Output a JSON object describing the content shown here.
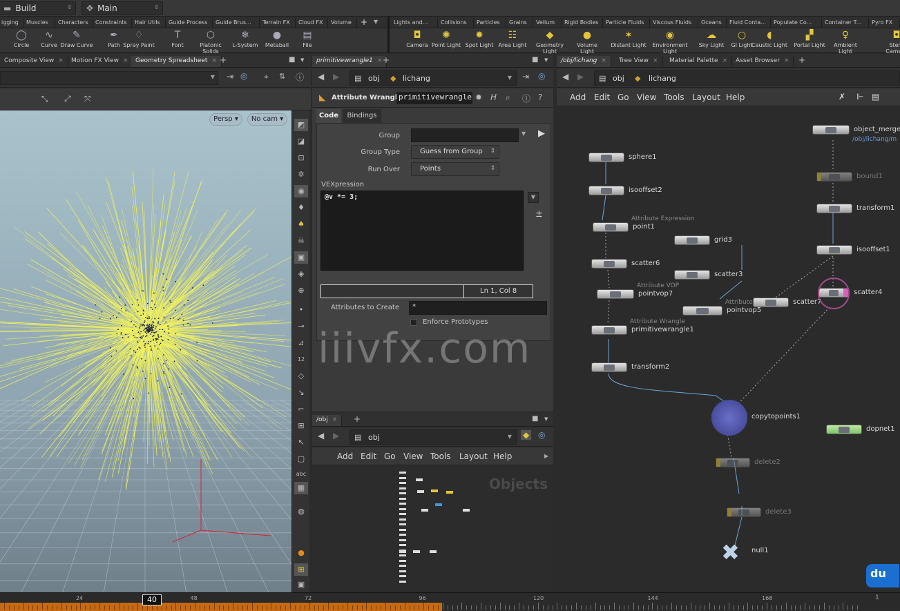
{
  "top": {
    "desktop": "Build",
    "desk2": "Main"
  },
  "shelf_tabs_left": [
    "igging",
    "Muscles",
    "Characters",
    "Constraints",
    "Hair Utils",
    "Guide Process",
    "Guide Brus...",
    "Terrain FX",
    "Cloud FX",
    "Volume"
  ],
  "shelf_tabs_right": [
    "Lights and...",
    "Collisions",
    "Particles",
    "Grains",
    "Vellum",
    "Rigid Bodies",
    "Particle Fluids",
    "Viscous Fluids",
    "Oceans",
    "Fluid Conta...",
    "Populate Co...",
    "Container T...",
    "Pyro FX"
  ],
  "tools_left": [
    {
      "label": "Circle",
      "icon": "circle-icon"
    },
    {
      "label": "Curve",
      "icon": "curve-icon"
    },
    {
      "label": "Draw Curve",
      "icon": "draw-curve-icon"
    },
    {
      "label": "Path",
      "icon": "path-icon"
    },
    {
      "label": "Spray Paint",
      "icon": "spray-paint-icon"
    },
    {
      "label": "Font",
      "icon": "font-icon"
    },
    {
      "label": "Platonic Solids",
      "icon": "platonic-icon"
    },
    {
      "label": "L-System",
      "icon": "lsystem-icon"
    },
    {
      "label": "Metaball",
      "icon": "metaball-icon"
    },
    {
      "label": "File",
      "icon": "file-icon"
    }
  ],
  "tools_right": [
    {
      "label": "Camera",
      "icon": "camera-icon"
    },
    {
      "label": "Point Light",
      "icon": "point-light-icon"
    },
    {
      "label": "Spot Light",
      "icon": "spot-light-icon"
    },
    {
      "label": "Area Light",
      "icon": "area-light-icon"
    },
    {
      "label": "Geometry Light",
      "icon": "geometry-light-icon"
    },
    {
      "label": "Volume Light",
      "icon": "volume-light-icon"
    },
    {
      "label": "Distant Light",
      "icon": "distant-light-icon"
    },
    {
      "label": "Environment Light",
      "icon": "env-light-icon"
    },
    {
      "label": "Sky Light",
      "icon": "sky-light-icon"
    },
    {
      "label": "GI Light",
      "icon": "gi-light-icon"
    },
    {
      "label": "Caustic Light",
      "icon": "caustic-light-icon"
    },
    {
      "label": "Portal Light",
      "icon": "portal-light-icon"
    },
    {
      "label": "Ambient Light",
      "icon": "ambient-light-icon"
    },
    {
      "label": "Stere Camera",
      "icon": "stereo-camera-icon"
    }
  ],
  "left_pane": {
    "tabs": [
      "Composite View",
      "Motion FX View",
      "Geometry Spreadsheet"
    ],
    "persp": "Persp ▾",
    "nocam": "No cam ▾"
  },
  "param_pane": {
    "tab": "primitivewrangle1",
    "path_obj": "obj",
    "path_node": "lichang",
    "node_type": "Attribute Wrangle",
    "node_name": "primitivewrangle",
    "subtabs": [
      "Code",
      "Bindings"
    ],
    "group_label": "Group",
    "group_value": "",
    "group_type_label": "Group Type",
    "group_type_value": "Guess from Group",
    "run_over_label": "Run Over",
    "run_over_value": "Points",
    "vex_label": "VEXpression",
    "vex_code": "@v *= 3;",
    "cursor": "Ln 1, Col 8",
    "attrs_label": "Attributes to Create",
    "attrs_value": "*",
    "enforce_label": "Enforce Prototypes"
  },
  "obj_pane": {
    "tab": "/obj",
    "path": "obj",
    "menu": [
      "Add",
      "Edit",
      "Go",
      "View",
      "Tools",
      "Layout",
      "Help"
    ],
    "watermark": "Objects"
  },
  "network": {
    "tabs": [
      "/obj/lichang",
      "Tree View",
      "Material Palette",
      "Asset Browser"
    ],
    "path_obj": "obj",
    "path_node": "lichang",
    "menu": [
      "Add",
      "Edit",
      "Go",
      "View",
      "Tools",
      "Layout",
      "Help"
    ],
    "nodes": [
      {
        "name": "sphere1",
        "sub": ""
      },
      {
        "name": "isooffset2",
        "sub": ""
      },
      {
        "name": "point1",
        "sub": "Attribute Expression"
      },
      {
        "name": "scatter6",
        "sub": ""
      },
      {
        "name": "pointvop7",
        "sub": "Attribute VOP"
      },
      {
        "name": "primitivewrangle1",
        "sub": "Attribute Wrangle"
      },
      {
        "name": "transform2",
        "sub": ""
      },
      {
        "name": "grid3",
        "sub": ""
      },
      {
        "name": "scatter3",
        "sub": ""
      },
      {
        "name": "pointvop5",
        "sub": "Attribute VOP"
      },
      {
        "name": "scatter7",
        "sub": ""
      },
      {
        "name": "object_merge1",
        "sub": "/obj/lichang/m"
      },
      {
        "name": "bound1",
        "sub": ""
      },
      {
        "name": "transform1",
        "sub": ""
      },
      {
        "name": "isooffset1",
        "sub": ""
      },
      {
        "name": "scatter4",
        "sub": ""
      },
      {
        "name": "copytopoints1",
        "sub": ""
      },
      {
        "name": "dopnet1",
        "sub": ""
      },
      {
        "name": "delete2",
        "sub": ""
      },
      {
        "name": "delete3",
        "sub": ""
      },
      {
        "name": "null1",
        "sub": ""
      }
    ]
  },
  "timeline": {
    "ticks": [
      "24",
      "48",
      "72",
      "96",
      "120",
      "144",
      "168"
    ],
    "current": "40",
    "end_marker": "1"
  },
  "watermark": "iiivfx.com",
  "badge": "du"
}
